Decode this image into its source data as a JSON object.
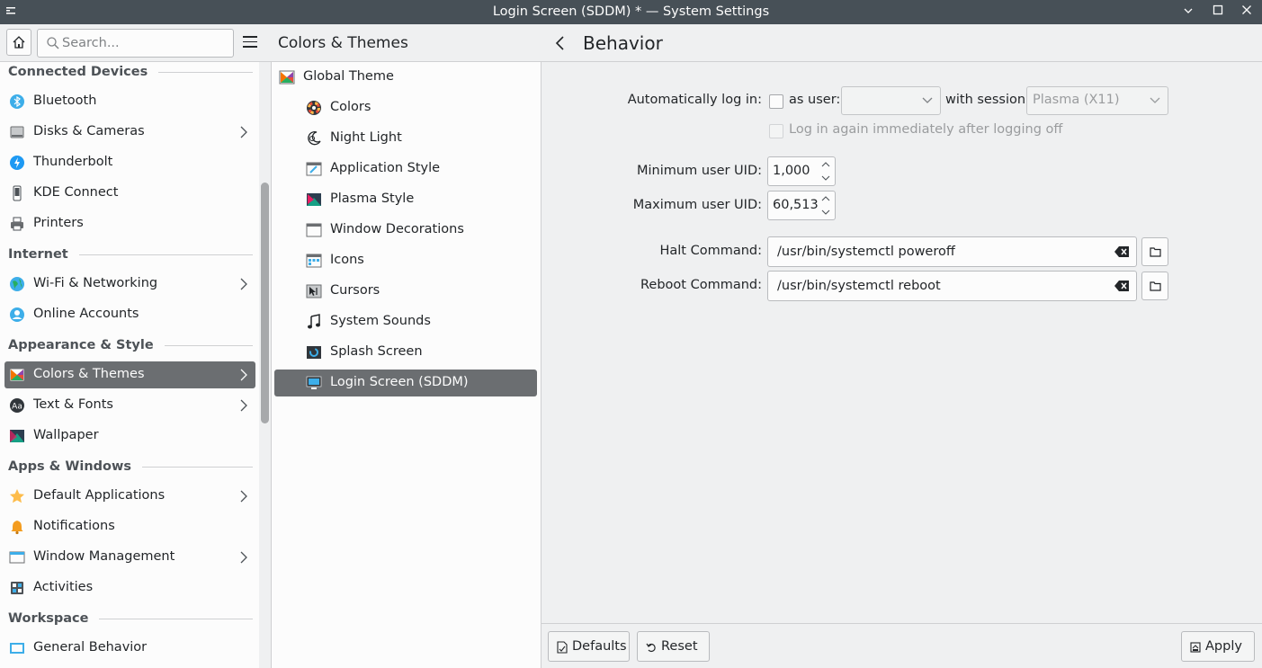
{
  "window": {
    "title": "Login Screen (SDDM) * — System Settings"
  },
  "sidebar": {
    "search_placeholder": "Search...",
    "groups": [
      {
        "header": "Connected Devices",
        "items": [
          {
            "label": "Bluetooth",
            "icon": "bluetooth-icon",
            "chevron": false
          },
          {
            "label": "Disks & Cameras",
            "icon": "disk-icon",
            "chevron": true
          },
          {
            "label": "Thunderbolt",
            "icon": "thunderbolt-icon",
            "chevron": false
          },
          {
            "label": "KDE Connect",
            "icon": "phone-icon",
            "chevron": false
          },
          {
            "label": "Printers",
            "icon": "printer-icon",
            "chevron": false
          }
        ]
      },
      {
        "header": "Internet",
        "items": [
          {
            "label": "Wi-Fi & Networking",
            "icon": "globe-icon",
            "chevron": true
          },
          {
            "label": "Online Accounts",
            "icon": "accounts-icon",
            "chevron": false
          }
        ]
      },
      {
        "header": "Appearance & Style",
        "items": [
          {
            "label": "Colors & Themes",
            "icon": "palette-icon",
            "chevron": true,
            "selected": true
          },
          {
            "label": "Text & Fonts",
            "icon": "font-icon",
            "chevron": true
          },
          {
            "label": "Wallpaper",
            "icon": "wallpaper-icon",
            "chevron": false
          }
        ]
      },
      {
        "header": "Apps & Windows",
        "items": [
          {
            "label": "Default Applications",
            "icon": "star-icon",
            "chevron": true
          },
          {
            "label": "Notifications",
            "icon": "bell-icon",
            "chevron": false
          },
          {
            "label": "Window Management",
            "icon": "window-icon",
            "chevron": true
          },
          {
            "label": "Activities",
            "icon": "activities-icon",
            "chevron": false
          }
        ]
      },
      {
        "header": "Workspace",
        "items": [
          {
            "label": "General Behavior",
            "icon": "general-behavior-icon",
            "chevron": false
          }
        ]
      }
    ]
  },
  "middle": {
    "title": "Colors & Themes",
    "items": [
      {
        "label": "Global Theme",
        "icon": "global-theme-icon",
        "sub": false
      },
      {
        "label": "Colors",
        "icon": "colors-icon",
        "sub": true
      },
      {
        "label": "Night Light",
        "icon": "night-light-icon",
        "sub": true
      },
      {
        "label": "Application Style",
        "icon": "application-style-icon",
        "sub": true
      },
      {
        "label": "Plasma Style",
        "icon": "plasma-style-icon",
        "sub": true
      },
      {
        "label": "Window Decorations",
        "icon": "window-decorations-icon",
        "sub": true
      },
      {
        "label": "Icons",
        "icon": "icons-icon",
        "sub": true
      },
      {
        "label": "Cursors",
        "icon": "cursors-icon",
        "sub": true
      },
      {
        "label": "System Sounds",
        "icon": "music-note-icon",
        "sub": true
      },
      {
        "label": "Splash Screen",
        "icon": "splash-screen-icon",
        "sub": true
      },
      {
        "label": "Login Screen (SDDM)",
        "icon": "monitor-icon",
        "sub": true,
        "selected": true
      }
    ]
  },
  "page": {
    "title": "Behavior",
    "autologin_label": "Automatically log in:",
    "as_user_label": "as user:",
    "user_value": "",
    "with_session_label": "with session",
    "session_value": "Plasma (X11)",
    "relogin_label": "Log in again immediately after logging off",
    "min_uid_label": "Minimum user UID:",
    "min_uid_value": "1,000",
    "max_uid_label": "Maximum user UID:",
    "max_uid_value": "60,513",
    "halt_label": "Halt Command:",
    "halt_value": "/usr/bin/systemctl poweroff",
    "reboot_label": "Reboot Command:",
    "reboot_value": "/usr/bin/systemctl reboot"
  },
  "buttons": {
    "defaults": "Defaults",
    "reset": "Reset",
    "apply": "Apply"
  }
}
